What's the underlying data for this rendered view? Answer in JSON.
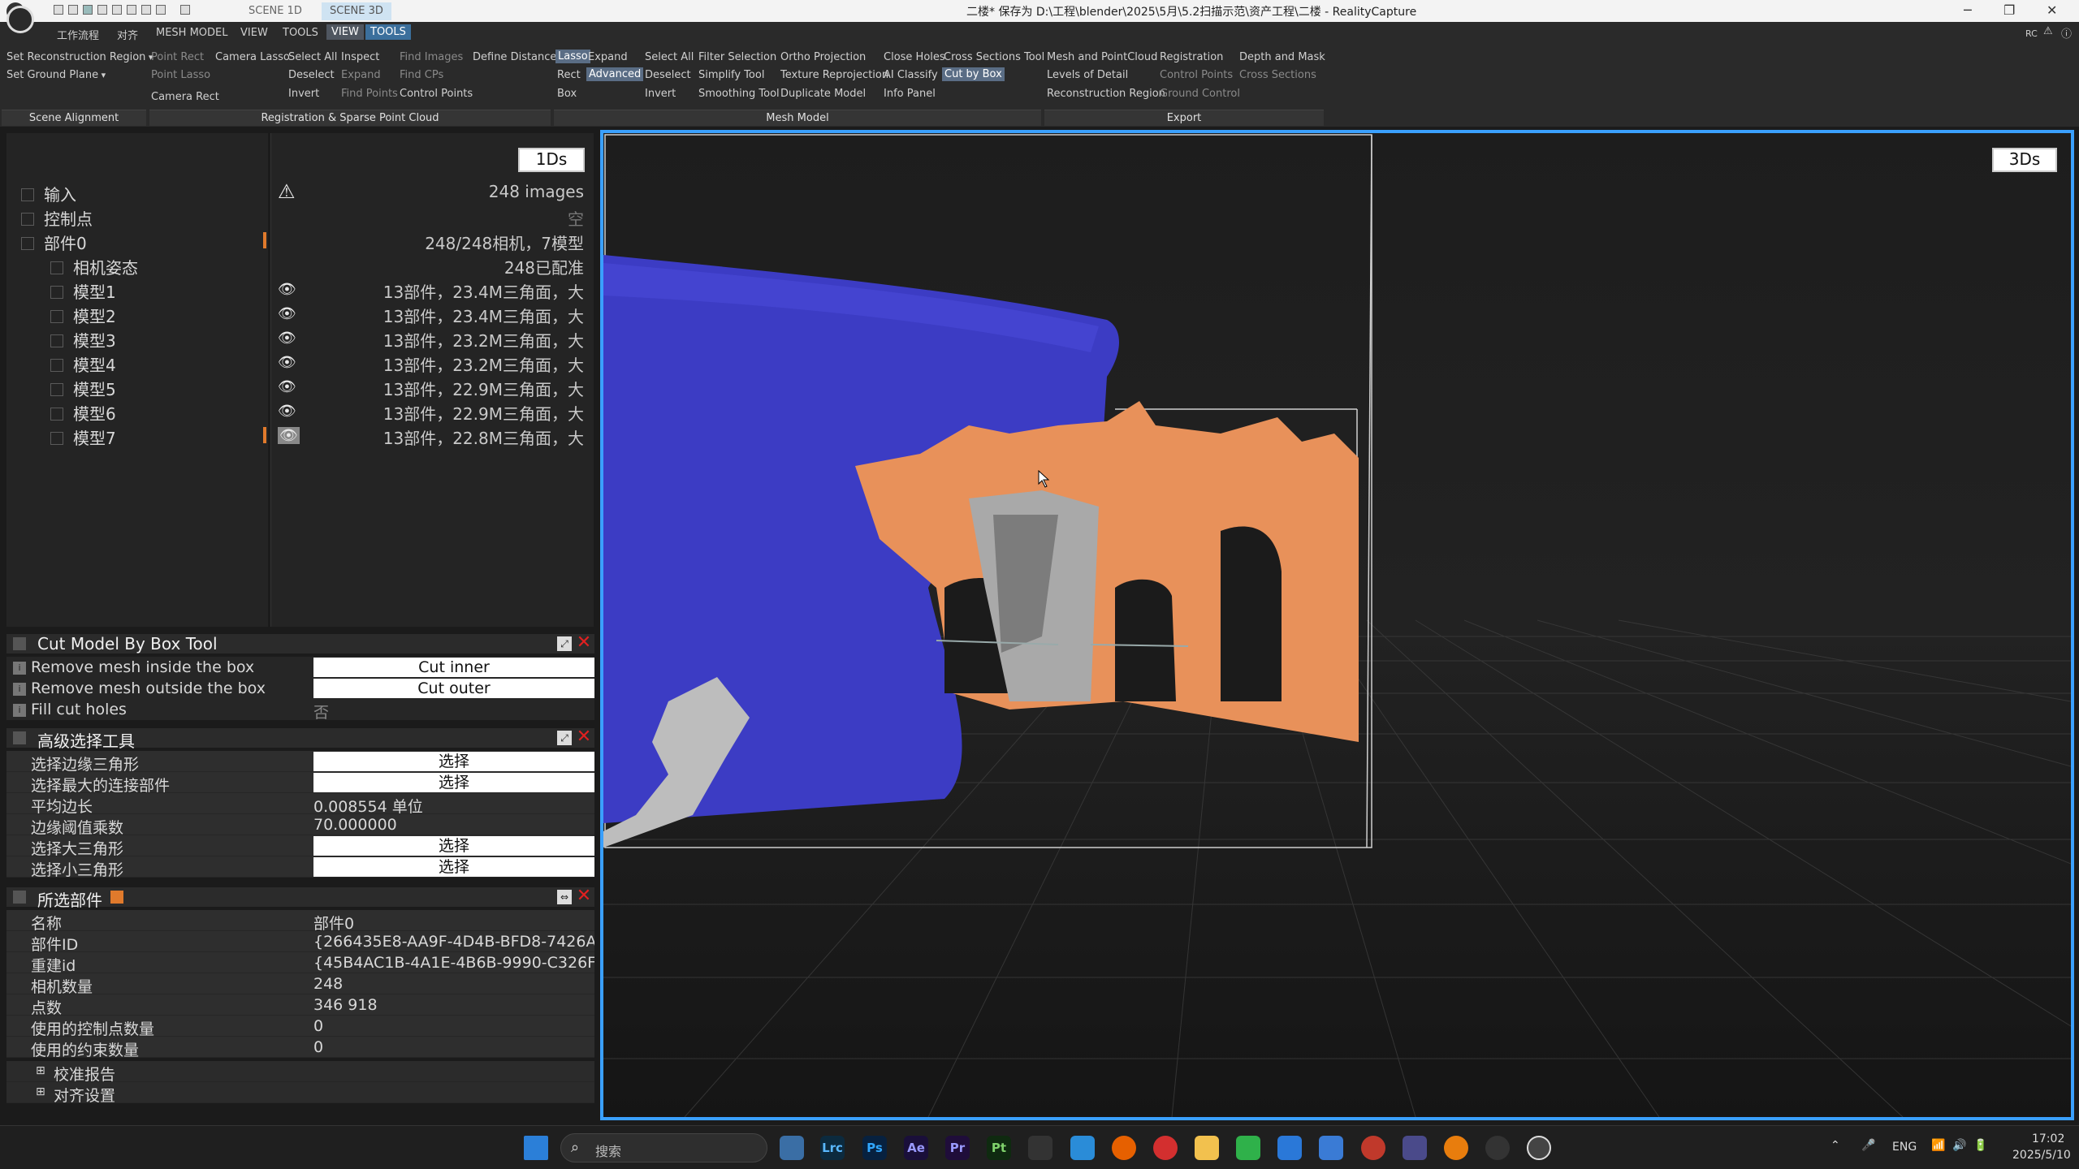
{
  "window": {
    "title": "二楼* 保存为 D:\\工程\\blender\\2025\\5月\\5.2扫描示范\\资产工程\\二楼 - RealityCapture",
    "scene_tabs": [
      "SCENE 1D",
      "SCENE 3D"
    ],
    "controls": {
      "minimize": "─",
      "maximize": "❐",
      "close": "✕"
    }
  },
  "menu": {
    "items": [
      "工作流程",
      "对齐",
      "MESH MODEL",
      "VIEW",
      "TOOLS"
    ],
    "context": [
      "VIEW",
      "TOOLS"
    ],
    "right": "RC"
  },
  "ribbon": {
    "scene_alignment": {
      "label": "Scene Alignment",
      "items": [
        "Set Reconstruction Region",
        "Set Ground Plane"
      ]
    },
    "registration": {
      "label": "Registration & Sparse Point Cloud",
      "col1": [
        "Point Rect",
        "Point Lasso",
        "Camera Rect"
      ],
      "col2": [
        "Camera Lasso"
      ],
      "col3": [
        "Select All",
        "Deselect",
        "Invert"
      ],
      "col4": [
        "Inspect",
        "Expand",
        "Find Points"
      ],
      "col5": [
        "Find Images",
        "Find CPs",
        "Control Points"
      ],
      "col6": [
        "Define Distance"
      ]
    },
    "mesh_model": {
      "label": "Mesh Model",
      "col1": [
        "Lasso",
        "Rect",
        "Box"
      ],
      "col2": [
        "Expand",
        "Advanced"
      ],
      "col3": [
        "Select All",
        "Deselect",
        "Invert"
      ],
      "col4": [
        "Filter Selection",
        "Simplify Tool",
        "Smoothing Tool"
      ],
      "col5": [
        "Ortho Projection",
        "Texture Reprojection",
        "Duplicate Model"
      ],
      "col6": [
        "Close Holes",
        "AI Classify",
        "Info Panel"
      ],
      "col7": [
        "Cross Sections Tool",
        "Cut by Box"
      ]
    },
    "export": {
      "label": "Export",
      "col1": [
        "Mesh and PointCloud",
        "Levels of Detail",
        "Reconstruction Region"
      ],
      "col2": [
        "Registration",
        "Control Points",
        "Ground Control"
      ],
      "col3": [
        "Depth and Mask",
        "Cross Sections"
      ]
    }
  },
  "tree": {
    "button": "1Ds",
    "rows": [
      {
        "label": "输入",
        "info": "248 images"
      },
      {
        "label": "控制点",
        "info": "空"
      },
      {
        "label": "部件0",
        "info": "248/248相机，7模型"
      },
      {
        "label": "相机姿态",
        "info": "248已配准"
      },
      {
        "label": "模型1",
        "info": "13部件，23.4M三角面，大"
      },
      {
        "label": "模型2",
        "info": "13部件，23.4M三角面，大"
      },
      {
        "label": "模型3",
        "info": "13部件，23.2M三角面，大"
      },
      {
        "label": "模型4",
        "info": "13部件，23.2M三角面，大"
      },
      {
        "label": "模型5",
        "info": "13部件，22.9M三角面，大"
      },
      {
        "label": "模型6",
        "info": "13部件，22.9M三角面，大"
      },
      {
        "label": "模型7",
        "info": "13部件，22.8M三角面，大"
      }
    ]
  },
  "cut_tool": {
    "title": "Cut Model By Box Tool",
    "rows": [
      {
        "label": "Remove mesh inside the box",
        "button": "Cut inner"
      },
      {
        "label": "Remove mesh outside the box",
        "button": "Cut outer"
      },
      {
        "label": "Fill cut holes",
        "value": "否"
      }
    ]
  },
  "adv_select": {
    "title": "高级选择工具",
    "rows": [
      {
        "label": "选择边缘三角形",
        "button": "选择"
      },
      {
        "label": "选择最大的连接部件",
        "button": "选择"
      },
      {
        "label": "平均边长",
        "value": "0.008554 单位"
      },
      {
        "label": "边缘阈值乘数",
        "value": "70.000000"
      },
      {
        "label": "选择大三角形",
        "button": "选择"
      },
      {
        "label": "选择小三角形",
        "button": "选择"
      }
    ]
  },
  "selected_component": {
    "title": "所选部件",
    "rows": [
      {
        "label": "名称",
        "value": "部件0"
      },
      {
        "label": "部件ID",
        "value": "{266435E8-AA9F-4D4B-BFD8-7426A..."
      },
      {
        "label": "重建id",
        "value": "{45B4AC1B-4A1E-4B6B-9990-C326F..."
      },
      {
        "label": "相机数量",
        "value": "248"
      },
      {
        "label": "点数",
        "value": "346 918"
      },
      {
        "label": "使用的控制点数量",
        "value": "0"
      },
      {
        "label": "使用的约束数量",
        "value": "0"
      }
    ],
    "groups": [
      "校准报告",
      "对齐设置"
    ]
  },
  "viewport": {
    "button": "3Ds"
  },
  "taskbar": {
    "search_placeholder": "搜索",
    "apps": [
      "Lrc",
      "Ps",
      "Ae",
      "Pr",
      "Pt"
    ],
    "lang": "ENG",
    "time": "17:02",
    "date": "2025/5/10"
  },
  "colors": {
    "accent_blue": "#3aa0ff",
    "mesh_blue": "#3f3fc6",
    "mesh_orange": "#e8915a",
    "close_red": "#e02020",
    "mark_orange": "#e07a2c"
  }
}
